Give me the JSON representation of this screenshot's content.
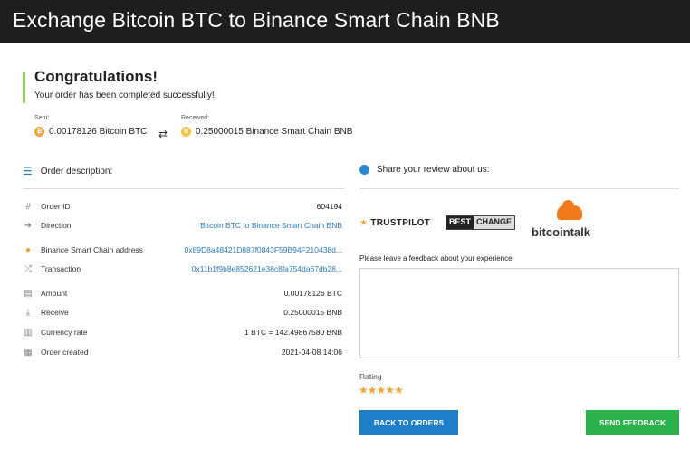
{
  "header": {
    "title": "Exchange Bitcoin BTC to Binance Smart Chain BNB"
  },
  "status": {
    "heading": "Congratulations!",
    "message": "Your order has been completed successfully!"
  },
  "transfer": {
    "sent_label": "Sent:",
    "sent_amount": "0.00178126 Bitcoin BTC",
    "received_label": "Received:",
    "received_amount": "0.25000015 Binance Smart Chain BNB"
  },
  "order": {
    "section_title": "Order description:",
    "rows": [
      {
        "icon": "hash-icon",
        "label": "Order ID",
        "value": "604194",
        "link": false
      },
      {
        "icon": "direction-icon",
        "label": "Direction",
        "value": "Bitcoin BTC to Binance Smart Chain BNB",
        "link": true
      },
      {
        "icon": "bnb-coin-icon",
        "label": "Binance Smart Chain address",
        "value": "0x89D8a48421D887f0843F59B94F210438d...",
        "link": true
      },
      {
        "icon": "shuffle-icon",
        "label": "Transaction",
        "value": "0x11b1f9b8e852621e38c8fa754da67db28...",
        "link": true
      },
      {
        "icon": "calculator-icon",
        "label": "Amount",
        "value": "0.00178126 BTC",
        "link": false
      },
      {
        "icon": "download-icon",
        "label": "Receive",
        "value": "0.25000015 BNB",
        "link": false
      },
      {
        "icon": "bar-chart-icon",
        "label": "Currency rate",
        "value": "1 BTC = 142.49867580 BNB",
        "link": false
      },
      {
        "icon": "calendar-icon",
        "label": "Order created",
        "value": "2021-04-08 14:06",
        "link": false
      }
    ]
  },
  "review": {
    "section_title": "Share your review about us:",
    "logos": {
      "trustpilot": "TRUSTPILOT",
      "bestchange_1": "BEST",
      "bestchange_2": "CHANGE",
      "bitcointalk": "bitcointalk"
    },
    "feedback_label": "Please leave a feedback about your experience:",
    "feedback_value": "",
    "rating_label": "Rating",
    "rating_value": 5,
    "rating_max": 5
  },
  "buttons": {
    "back": "BACK TO ORDERS",
    "send": "SEND FEEDBACK"
  },
  "colors": {
    "accent_blue": "#1f7ec8",
    "accent_green": "#2cb24a",
    "success_bar": "#8ccf5a",
    "star": "#f2a33a"
  }
}
